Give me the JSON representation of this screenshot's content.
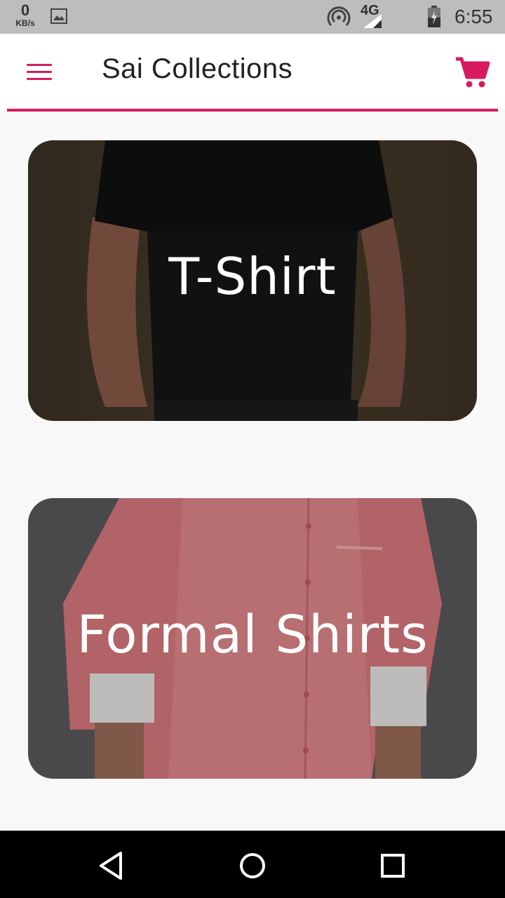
{
  "status_bar": {
    "speed_value": "0",
    "speed_unit": "KB/s",
    "network": "4G",
    "time": "6:55",
    "icons": [
      "gallery-icon",
      "hotspot-icon",
      "signal-icon",
      "battery-icon"
    ]
  },
  "app_bar": {
    "title": "Sai Collections",
    "menu_icon": "hamburger-menu-icon",
    "cart_icon": "shopping-cart-icon",
    "accent_color": "#d81b60"
  },
  "categories": [
    {
      "label": "T-Shirt"
    },
    {
      "label": "Formal Shirts"
    }
  ],
  "nav_bar": {
    "icons": [
      "back-icon",
      "home-icon",
      "recent-apps-icon"
    ]
  }
}
